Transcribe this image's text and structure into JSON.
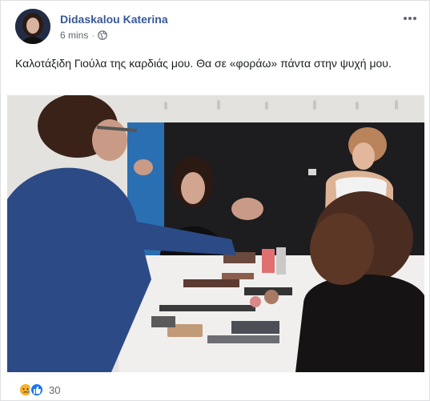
{
  "post": {
    "author": "Didaskalou Katerina",
    "time": "6 mins",
    "separator": "·",
    "privacy_icon": "globe-icon",
    "more_icon": "ellipsis-icon",
    "caption": "Καλοτάξιδη Γιούλα της καρδιάς μου. Θα σε «φοράω» πάντα στην ψυχή μου.",
    "photo_icon": "makeup-room-photo",
    "reactions": {
      "icons": [
        "sad-reaction-icon",
        "like-reaction-icon"
      ],
      "count": "30"
    }
  },
  "colors": {
    "author_link": "#385898",
    "meta_text": "#616770",
    "like_blue": "#1877f2",
    "sad_yellow": "#f7b125"
  }
}
